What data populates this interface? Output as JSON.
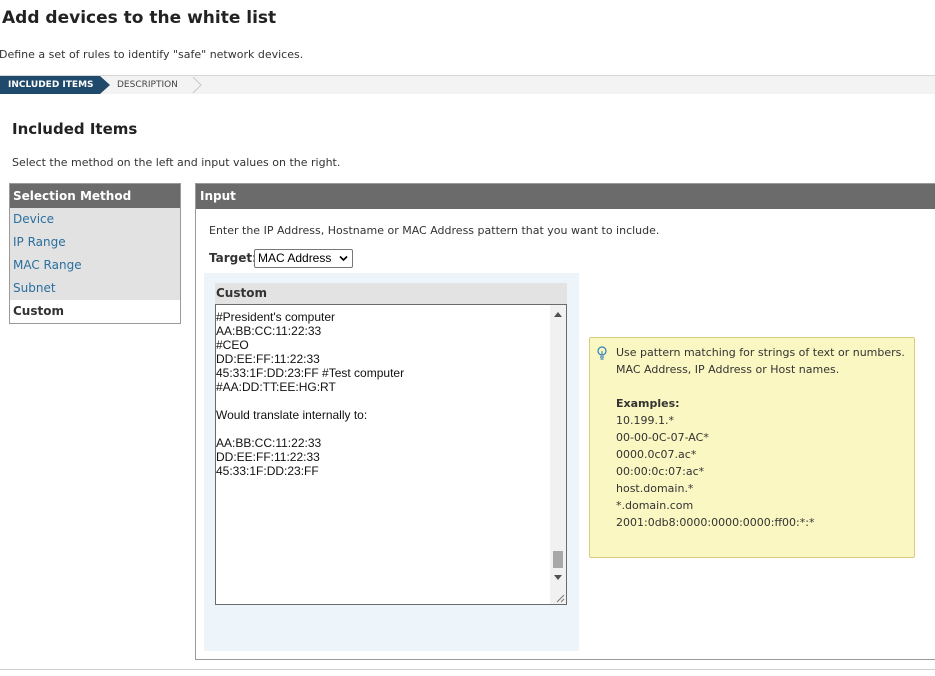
{
  "page": {
    "title": "Add devices to the white list",
    "subtitle": "Define a set of rules to identify \"safe\" network devices."
  },
  "wizard": {
    "steps": [
      {
        "label": "INCLUDED ITEMS",
        "active": true
      },
      {
        "label": "DESCRIPTION",
        "active": false
      }
    ]
  },
  "section": {
    "title": "Included Items",
    "description": "Select the method on the left and input values on the right."
  },
  "selection_method": {
    "header": "Selection Method",
    "items": [
      {
        "label": "Device",
        "selected": false
      },
      {
        "label": "IP Range",
        "selected": false
      },
      {
        "label": "MAC Range",
        "selected": false
      },
      {
        "label": "Subnet",
        "selected": false
      },
      {
        "label": "Custom",
        "selected": true
      }
    ]
  },
  "input": {
    "header": "Input",
    "instructions": "Enter the IP Address, Hostname or MAC Address pattern that you want to include.",
    "target_label": "Target:",
    "target_value": "MAC Address",
    "custom_label": "Custom",
    "custom_text": "#President's computer\nAA:BB:CC:11:22:33\n#CEO\nDD:EE:FF:11:22:33\n45:33:1F:DD:23:FF #Test computer\n#AA:DD:TT:EE:HG:RT\n\nWould translate internally to:\n\nAA:BB:CC:11:22:33\nDD:EE:FF:11:22:33\n45:33:1F:DD:23:FF"
  },
  "hint": {
    "icon": "lightbulb-icon",
    "text_line1": "Use pattern matching for strings of text or numbers.",
    "text_line2": "MAC Address, IP Address or Host names.",
    "examples_label": "Examples:",
    "examples": [
      "10.199.1.*",
      "00-00-0C-07-AC*",
      "0000.0c07.ac*",
      "00:00:0c:07:ac*",
      "host.domain.*",
      "*.domain.com",
      "2001:0db8:0000:0000:0000:ff00:*:*"
    ]
  },
  "colors": {
    "accent": "#204a6b",
    "panel_header": "#6b6b6b",
    "link": "#2a6f9e",
    "hint_bg": "#fbf7c2",
    "custom_bg": "#edf4fa"
  }
}
